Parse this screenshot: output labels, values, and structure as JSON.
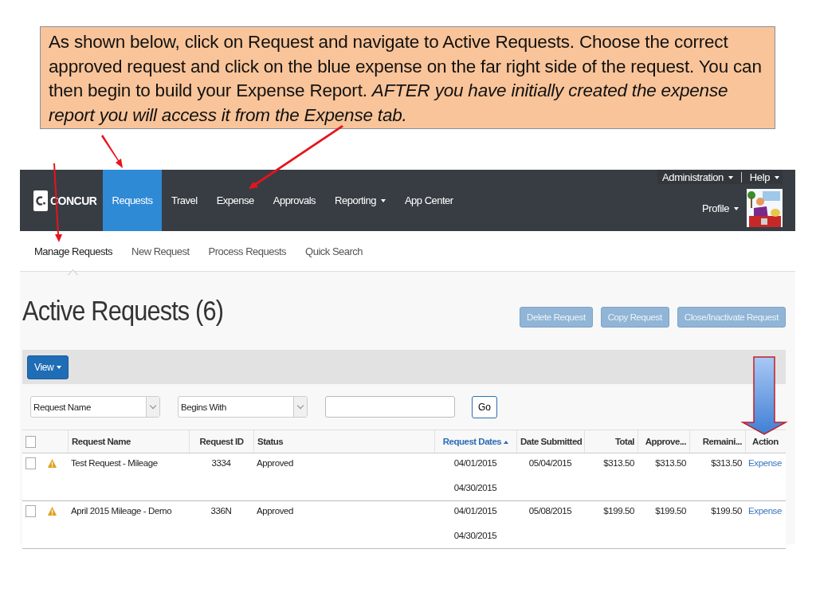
{
  "callout": {
    "text": "As shown below, click on Request and navigate to Active Requests.  Choose the correct approved request and click on the blue expense on the far right side of the request. You can then begin to build your Expense Report. *AFTER you have initially created the expense report you will access it from the Expense tab.*"
  },
  "nav": {
    "logo": "CONCUR",
    "items": [
      {
        "label": "Requests",
        "selected": true,
        "dropdown": false
      },
      {
        "label": "Travel",
        "selected": false,
        "dropdown": false
      },
      {
        "label": "Expense",
        "selected": false,
        "dropdown": false
      },
      {
        "label": "Approvals",
        "selected": false,
        "dropdown": false
      },
      {
        "label": "Reporting",
        "selected": false,
        "dropdown": true
      },
      {
        "label": "App Center",
        "selected": false,
        "dropdown": false
      }
    ],
    "administration": "Administration",
    "help": "Help",
    "profile": "Profile"
  },
  "subnav": [
    {
      "label": "Manage Requests",
      "selected": true
    },
    {
      "label": "New Request",
      "selected": false
    },
    {
      "label": "Process Requests",
      "selected": false
    },
    {
      "label": "Quick Search",
      "selected": false
    }
  ],
  "page_title": "Active Requests (6)",
  "actions": [
    {
      "label": "Delete Request",
      "disabled": true
    },
    {
      "label": "Copy Request",
      "disabled": true
    },
    {
      "label": "Close/Inactivate Request",
      "disabled": true
    }
  ],
  "view_button": "View",
  "filters": {
    "field": "Request Name",
    "operator": "Begins With",
    "go": "Go"
  },
  "table": {
    "select_all_checked": false,
    "columns": [
      {
        "label": "Request Name",
        "sorted": false
      },
      {
        "label": "Request ID",
        "sorted": false
      },
      {
        "label": "Status",
        "sorted": false
      },
      {
        "label": "Request Dates",
        "sorted": true
      },
      {
        "label": "Date Submitted",
        "sorted": false
      },
      {
        "label": "Total",
        "sorted": false
      },
      {
        "label": "Approve...",
        "sorted": false
      },
      {
        "label": "Remaini...",
        "sorted": false
      },
      {
        "label": "Action",
        "sorted": false
      }
    ],
    "rows": [
      {
        "checked": false,
        "warning": true,
        "name": "Test Request - Mileage",
        "id": "3334",
        "status": "Approved",
        "date_start": "04/01/2015",
        "date_end": "04/30/2015",
        "submitted": "05/04/2015",
        "total": "$313.50",
        "approved": "$313.50",
        "remaining": "$313.50",
        "action": "Expense"
      },
      {
        "checked": false,
        "warning": true,
        "name": "April 2015 Mileage - Demo",
        "id": "336N",
        "status": "Approved",
        "date_start": "04/01/2015",
        "date_end": "04/30/2015",
        "submitted": "05/08/2015",
        "total": "$199.50",
        "approved": "$199.50",
        "remaining": "$199.50",
        "action": "Expense"
      }
    ]
  }
}
